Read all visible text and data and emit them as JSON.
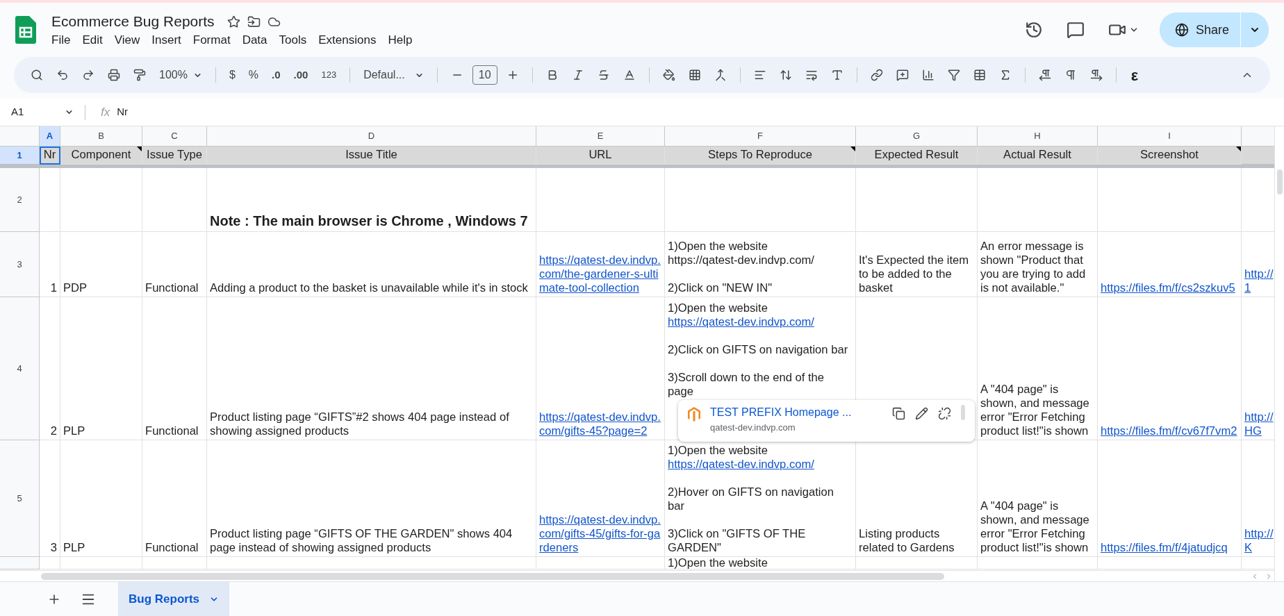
{
  "app": {
    "title": "Ecommerce Bug Reports",
    "menu": [
      "File",
      "Edit",
      "View",
      "Insert",
      "Format",
      "Data",
      "Tools",
      "Extensions",
      "Help"
    ],
    "share": "Share"
  },
  "toolbar": {
    "zoom": "100%",
    "currency": "$",
    "percent": "%",
    "decimal_decrease": ".0",
    "decimal_increase": ".00",
    "more_formats": "123",
    "font": "Defaul...",
    "font_size": "10",
    "equation": "ε"
  },
  "formula_bar": {
    "name_box": "A1",
    "function_symbol": "fx",
    "formula": "Nr"
  },
  "column_letters": [
    {
      "label": "A",
      "selected": true
    },
    {
      "label": "B",
      "selected": false
    },
    {
      "label": "C",
      "selected": false
    },
    {
      "label": "D",
      "selected": false
    },
    {
      "label": "E",
      "selected": false
    },
    {
      "label": "F",
      "selected": false
    },
    {
      "label": "G",
      "selected": false
    },
    {
      "label": "H",
      "selected": false
    },
    {
      "label": "I",
      "selected": false
    }
  ],
  "header_row": {
    "number": "1",
    "selected": true,
    "cells": [
      {
        "text": "Nr",
        "note": false
      },
      {
        "text": "Component",
        "note": true
      },
      {
        "text": "Issue Type",
        "note": false
      },
      {
        "text": "Issue Title",
        "note": false
      },
      {
        "text": "URL",
        "note": false
      },
      {
        "text": "Steps To Reproduce",
        "note": true
      },
      {
        "text": "Expected Result",
        "note": false
      },
      {
        "text": "Actual Result",
        "note": false
      },
      {
        "text": "Screenshot",
        "note": true
      }
    ]
  },
  "rows": [
    {
      "number": "2",
      "note": "Note : The main browser is Chrome , Windows 7"
    },
    {
      "number": "3",
      "nr": "1",
      "component": "PDP",
      "issue_type": "Functional",
      "issue_title": "Adding a product to the basket is unavailable while it's in stock",
      "url": "https://qatest-dev.indvp.com/the-gardener-s-ultimate-tool-collection",
      "steps": [
        {
          "lines": [
            {
              "text": "1)Open the website",
              "kind": "text"
            },
            {
              "text": "https://qatest-dev.indvp.com/",
              "kind": "text"
            }
          ]
        },
        {
          "lines": [
            {
              "text": "2)Click on \"NEW IN\"",
              "kind": "text"
            }
          ]
        }
      ],
      "expected": "It's Expected the item to be added to the basket",
      "actual": "An error message is shown \"Product that you are trying to add is not available.\"",
      "screenshot": "https://files.fm/f/cs2szkuv5",
      "column_10": [
        "http://",
        "1"
      ]
    },
    {
      "number": "4",
      "nr": "2",
      "component": "PLP",
      "issue_type": "Functional",
      "issue_title": "Product listing page “GIFTS”#2 shows 404 page instead of showing assigned products",
      "url": "https://qatest-dev.indvp.com/gifts-45?page=2",
      "steps": [
        {
          "lines": [
            {
              "text": "1)Open the website",
              "kind": "text"
            },
            {
              "text": "https://qatest-dev.indvp.com/",
              "kind": "link"
            }
          ]
        },
        {
          "lines": [
            {
              "text": "2)Click on GIFTS on navigation bar",
              "kind": "text"
            }
          ]
        },
        {
          "lines": [
            {
              "text": "3)Scroll down to the end of the page",
              "kind": "text"
            }
          ]
        }
      ],
      "actual": "A \"404 page\" is shown, and message error \"Error Fetching product list!\"is shown",
      "screenshot": "https://files.fm/f/cv67f7vm2",
      "column_10": [
        "http://",
        "HG"
      ]
    },
    {
      "number": "5",
      "nr": "3",
      "component": "PLP",
      "issue_type": "Functional",
      "issue_title": "Product listing page “GIFTS OF THE GARDEN\" shows 404 page instead of showing assigned products",
      "url": "https://qatest-dev.indvp.com/gifts-45/gifts-for-gardeners",
      "steps": [
        {
          "lines": [
            {
              "text": "1)Open the website",
              "kind": "text"
            },
            {
              "text": "https://qatest-dev.indvp.com/",
              "kind": "link"
            }
          ]
        },
        {
          "lines": [
            {
              "text": "2)Hover on GIFTS on navigation bar",
              "kind": "text"
            }
          ]
        },
        {
          "lines": [
            {
              "text": "3)Click on \"GIFTS OF THE GARDEN\"",
              "kind": "text"
            }
          ]
        }
      ],
      "expected": "Listing products related to Gardens",
      "actual": "A \"404 page\" is shown, and message error \"Error Fetching product list!\"is shown",
      "screenshot": "https://files.fm/f/4jatudjcq",
      "column_10": [
        "http://",
        "K"
      ]
    },
    {
      "steps": [
        {
          "lines": [
            {
              "text": "1)Open the website",
              "kind": "text"
            }
          ]
        }
      ]
    }
  ],
  "link_popup": {
    "title": "TEST PREFIX Homepage ...",
    "url": "qatest-dev.indvp.com"
  },
  "sheet_tabs": [
    {
      "label": "Bug Reports",
      "selected": true
    }
  ]
}
